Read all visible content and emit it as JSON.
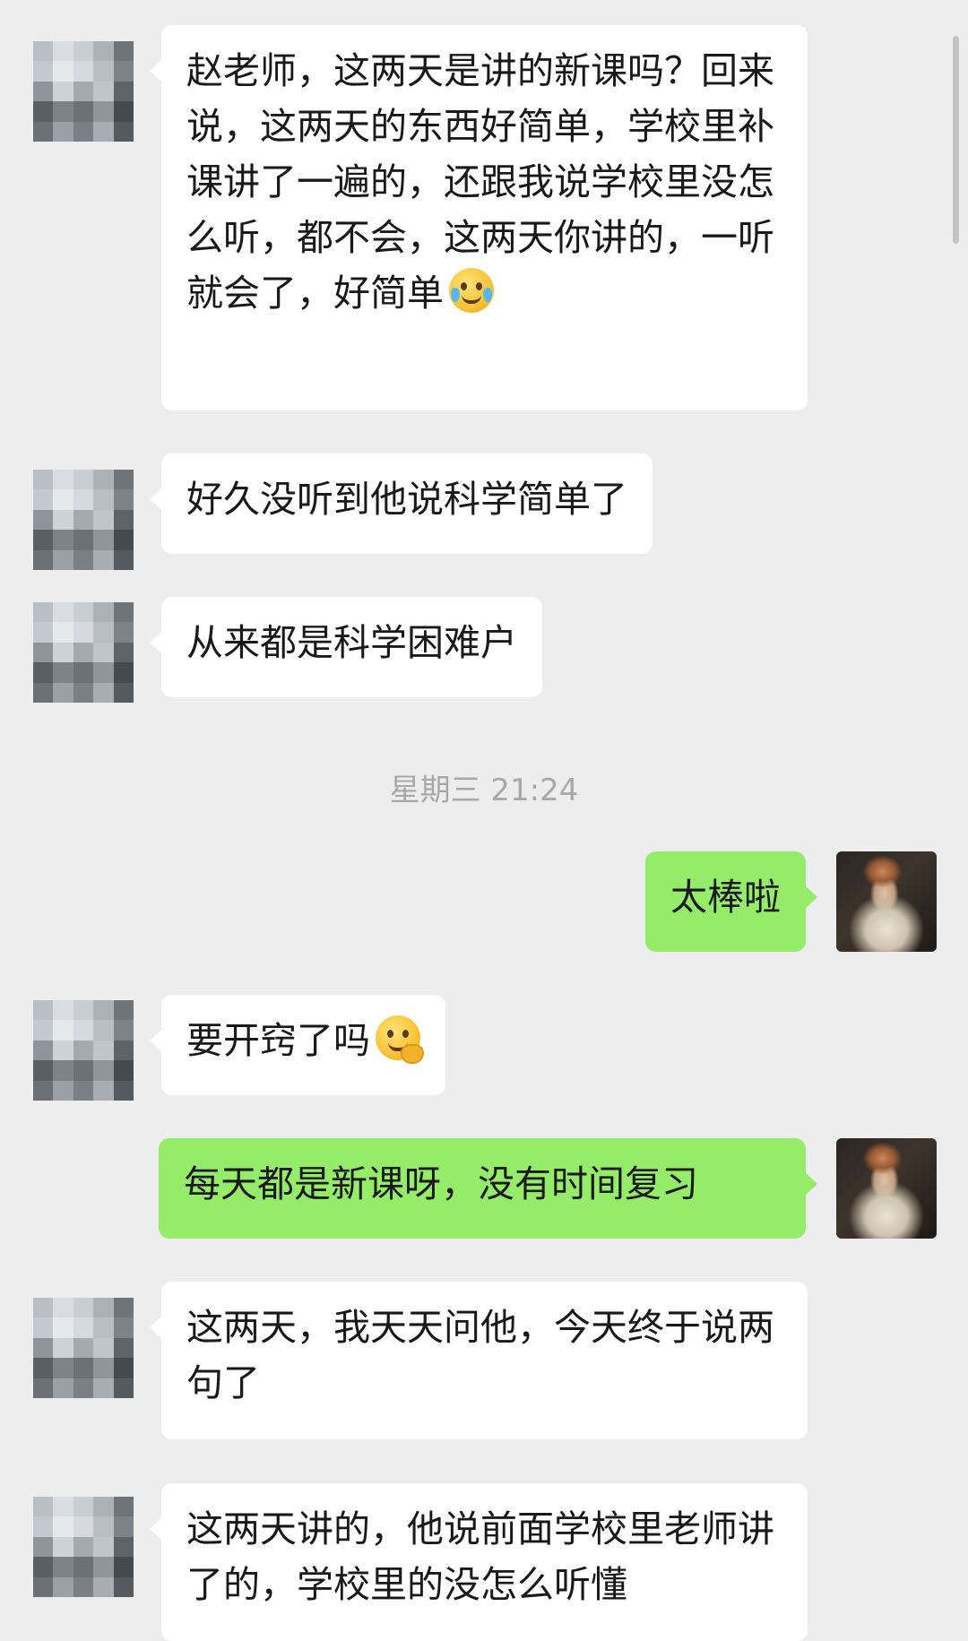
{
  "chat": {
    "messages": [
      {
        "direction": "in",
        "text": "赵老师，这两天是讲的新课吗？回来说，这两天的东西好简单，学校里补课讲了一遍的，还跟我说学校里没怎么听，都不会，这两天你讲的，一听就会了，好简单",
        "emoji": "face-with-tears-of-joy-icon"
      },
      {
        "direction": "in",
        "text": "好久没听到他说科学简单了"
      },
      {
        "direction": "in",
        "text": "从来都是科学困难户"
      },
      {
        "direction": "out",
        "text": "太棒啦"
      },
      {
        "direction": "in",
        "text": "要开窍了吗",
        "emoji": "thinking-hand-over-mouth-icon"
      },
      {
        "direction": "out",
        "text": "每天都是新课呀，没有时间复习"
      },
      {
        "direction": "in",
        "text": "这两天，我天天问他，今天终于说两句了"
      },
      {
        "direction": "in",
        "text": "这两天讲的，他说前面学校里老师讲了的，学校里的没怎么听懂"
      }
    ],
    "timestamp": "星期三 21:24"
  },
  "colors": {
    "background": "#ededed",
    "incoming_bubble": "#ffffff",
    "outgoing_bubble": "#95ec69",
    "timestamp_text": "#a8a8a8"
  }
}
